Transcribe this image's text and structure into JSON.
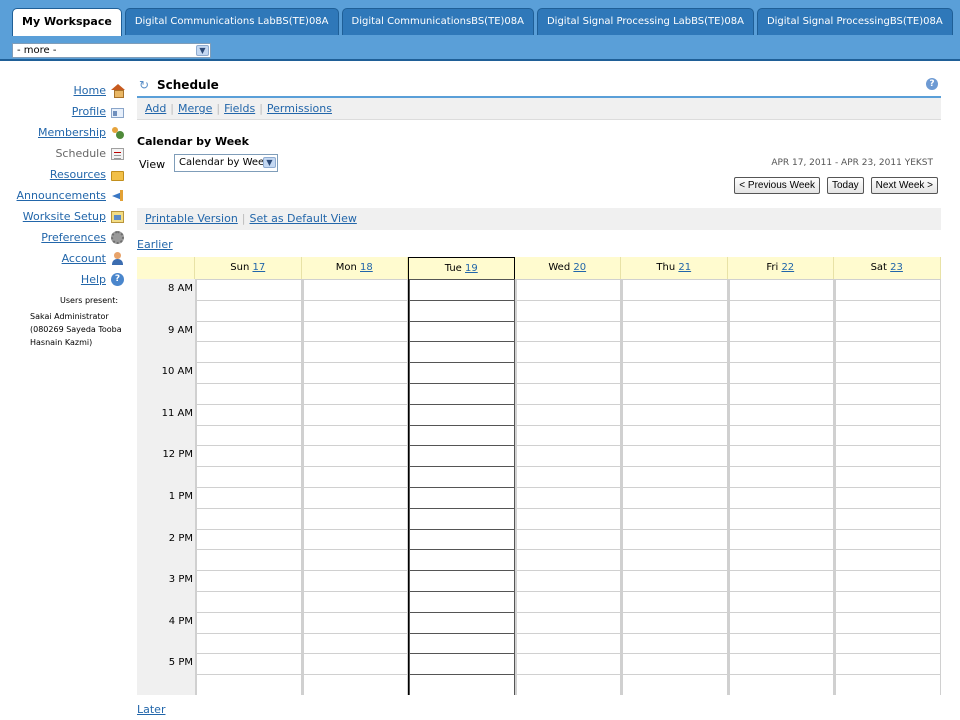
{
  "tabs": [
    {
      "label": "My Workspace",
      "active": true
    },
    {
      "label": "Digital Communications LabBS(TE)08A",
      "active": false
    },
    {
      "label": "Digital CommunicationsBS(TE)08A",
      "active": false
    },
    {
      "label": "Digital Signal Processing LabBS(TE)08A",
      "active": false
    },
    {
      "label": "Digital Signal ProcessingBS(TE)08A",
      "active": false
    }
  ],
  "more_select": {
    "value": "- more -"
  },
  "nav": {
    "items": [
      {
        "label": "Home",
        "icon": "home-icon"
      },
      {
        "label": "Profile",
        "icon": "profile-icon"
      },
      {
        "label": "Membership",
        "icon": "membership-icon"
      },
      {
        "label": "Schedule",
        "icon": "schedule-icon",
        "current": true
      },
      {
        "label": "Resources",
        "icon": "folder-icon"
      },
      {
        "label": "Announcements",
        "icon": "announcement-icon"
      },
      {
        "label": "Worksite Setup",
        "icon": "worksite-setup-icon"
      },
      {
        "label": "Preferences",
        "icon": "gear-icon"
      },
      {
        "label": "Account",
        "icon": "account-icon"
      },
      {
        "label": "Help",
        "icon": "help-icon"
      }
    ],
    "users_present_label": "Users present:",
    "users_present_names": "Sakai Administrator (080269 Sayeda Tooba Hasnain Kazmi)"
  },
  "tool": {
    "title": "Schedule",
    "help_glyph": "?",
    "actions": [
      "Add",
      "Merge",
      "Fields",
      "Permissions"
    ],
    "view_title": "Calendar by Week",
    "view_label": "View",
    "view_select_value": "Calendar by Week",
    "date_range": "APR 17, 2011 - APR 23, 2011 YEKST",
    "buttons": {
      "previous": "< Previous Week",
      "today": "Today",
      "next": "Next Week >"
    },
    "printable_version": "Printable Version",
    "set_default_view": "Set as Default View",
    "earlier": "Earlier",
    "later": "Later"
  },
  "calendar": {
    "days": [
      {
        "name": "Sun",
        "date": "17"
      },
      {
        "name": "Mon",
        "date": "18"
      },
      {
        "name": "Tue",
        "date": "19",
        "selected": true
      },
      {
        "name": "Wed",
        "date": "20"
      },
      {
        "name": "Thu",
        "date": "21"
      },
      {
        "name": "Fri",
        "date": "22"
      },
      {
        "name": "Sat",
        "date": "23"
      }
    ],
    "times": [
      "8 AM",
      "9 AM",
      "10 AM",
      "11 AM",
      "12 PM",
      "1 PM",
      "2 PM",
      "3 PM",
      "4 PM",
      "5 PM"
    ]
  },
  "colors": {
    "header_blue": "#5a9fd8",
    "link": "#2266aa",
    "calendar_header": "#fffbcf"
  }
}
